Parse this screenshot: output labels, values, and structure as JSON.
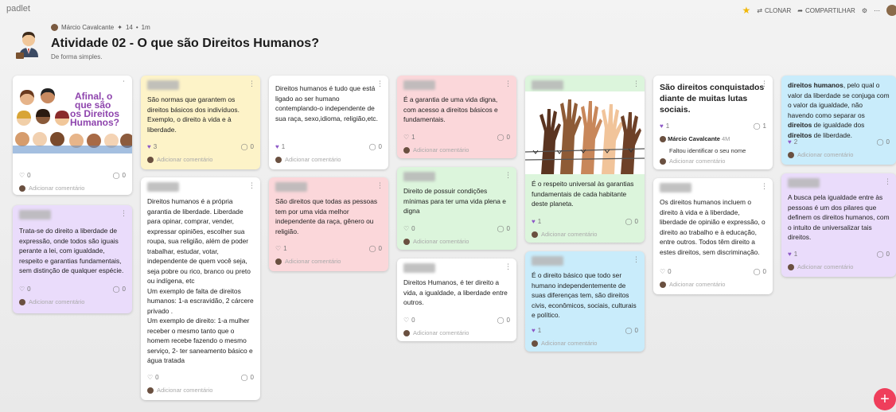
{
  "brand": "padlet",
  "actions": {
    "clone": "CLONAR",
    "share": "COMPARTILHAR"
  },
  "header": {
    "author": "Márcio Cavalcante",
    "likes": "14",
    "time": "1m",
    "title": "Atividade 02 - O que são Direitos Humanos?",
    "subtitle": "De forma simples."
  },
  "common": {
    "add_comment": "Adicionar comentário",
    "zero": "0",
    "one": "1"
  },
  "cards": {
    "c1": {
      "img_text_1": "Afinal, o",
      "img_text_2": "que são",
      "img_text_3": "os Direitos",
      "img_text_4": "Humanos?",
      "likes": "0",
      "comments": "0"
    },
    "c2": {
      "text": "Trata-se do direito a liberdade de expressão, onde todos são iguais perante a lei, com igualdade, respeito e garantias fundamentais, sem distinção de qualquer espécie.",
      "likes": "0",
      "comments": "0"
    },
    "c3": {
      "text": "São normas que garantem os direitos básicos dos indivíduos. Exemplo, o direito à vida e à liberdade.",
      "likes": "3",
      "comments": "0"
    },
    "c4": {
      "text": "Direitos humanos é a própria garantia de liberdade. Liberdade para opinar, comprar, vender, expressar opiniões, escolher sua roupa, sua religião, além de poder trabalhar, estudar, votar, independente de quem você seja, seja pobre ou rico, branco ou preto ou indígena, etc\nUm exemplo de falta de direitos humanos: 1-a escravidão, 2 cárcere privado .\nUm exemplo de direito: 1-a mulher receber o mesmo tanto que o homem recebe fazendo o mesmo serviço, 2- ter saneamento básico e água tratada",
      "likes": "0",
      "comments": "0"
    },
    "c5": {
      "text": "Direitos humanos é tudo que está ligado ao ser humano contemplando-o independente de sua raça, sexo,idioma, religião,etc.",
      "likes": "1",
      "comments": "0"
    },
    "c6": {
      "text": "São direitos que todas as pessoas tem por uma vida melhor independente da raça, gênero ou religião.",
      "likes": "1",
      "comments": "0"
    },
    "c7": {
      "text": "É a garantia de uma vida digna, com acesso a direitos básicos e fundamentais.",
      "likes": "1",
      "comments": "0"
    },
    "c8": {
      "text": "Direito de possuir condições mínimas para ter uma vida plena e digna",
      "likes": "0",
      "comments": "0"
    },
    "c9": {
      "text": "Direitos Humanos, é ter direito a vida, a igualdade, a liberdade entre outros.",
      "likes": "0",
      "comments": "0"
    },
    "c10": {
      "text": "É o respeito universal às garantias fundamentais de cada habitante deste planeta.",
      "likes": "1",
      "comments": "0"
    },
    "c11": {
      "text": "É o direito básico que todo ser humano independentemente de suas diferenças tem, são direitos civis, econômicos, sociais, culturais e político.",
      "likes": "1",
      "comments": "0"
    },
    "c12": {
      "text": "São direitos conquistados diante de muitas lutas sociais.",
      "likes": "1",
      "comments": "1",
      "comment_author": "Márcio Cavalcante",
      "comment_time": "4M",
      "comment_text": "Faltou identificar o seu nome"
    },
    "c13": {
      "text": "Os direitos humanos incluem o direito à vida e à liberdade, liberdade de opinião e expressão, o direito ao trabalho e à educação, entre outros. Todos têm direito a estes direitos, sem discriminação.",
      "likes": "0",
      "comments": "0"
    },
    "c14": {
      "text_pre": "direitos humanos",
      "text_mid": ", pelo qual o valor da liberdade se conjuga com o valor da igualdade, não havendo como separar os ",
      "text_b2": "direitos",
      "text_mid2": " de igualdade dos ",
      "text_b3": "direitos",
      "text_end": " de liberdade.",
      "likes": "2",
      "comments": "0"
    },
    "c15": {
      "text": "A busca pela igualdade entre às pessoas é um dos pilares que definem os direitos humanos, com o intuito de universalizar tais direitos.",
      "likes": "1",
      "comments": "0"
    }
  },
  "colors": {
    "yellow": "#fdf3c8",
    "pink": "#fbd7da",
    "green": "#dcf5dc",
    "blue": "#c9ecfb",
    "purple": "#eadcfb",
    "like": "#8d59c7",
    "fab": "#ef3e5b"
  }
}
